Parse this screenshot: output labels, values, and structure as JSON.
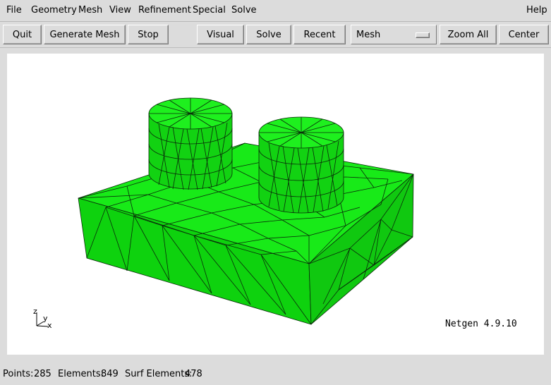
{
  "menubar": {
    "items": [
      "File",
      "Geometry",
      "Mesh",
      "View",
      "Refinement",
      "Special",
      "Solve"
    ],
    "help": "Help"
  },
  "toolbar": {
    "quit": "Quit",
    "generate_mesh": "Generate Mesh",
    "stop": "Stop",
    "visual": "Visual",
    "solve": "Solve",
    "recent": "Recent",
    "view_mode": "Mesh",
    "zoom_all": "Zoom All",
    "center": "Center"
  },
  "viewport": {
    "version": "Netgen 4.9.10",
    "axes": {
      "z": "z",
      "y": "y",
      "x": "x"
    },
    "mesh_color": "#12e612",
    "background": "#ffffff"
  },
  "status": {
    "points_label": "Points:",
    "points_value": "285",
    "elements_label": "Elements:",
    "elements_value": "849",
    "surf_label": "Surf Elements:",
    "surf_value": "478"
  }
}
